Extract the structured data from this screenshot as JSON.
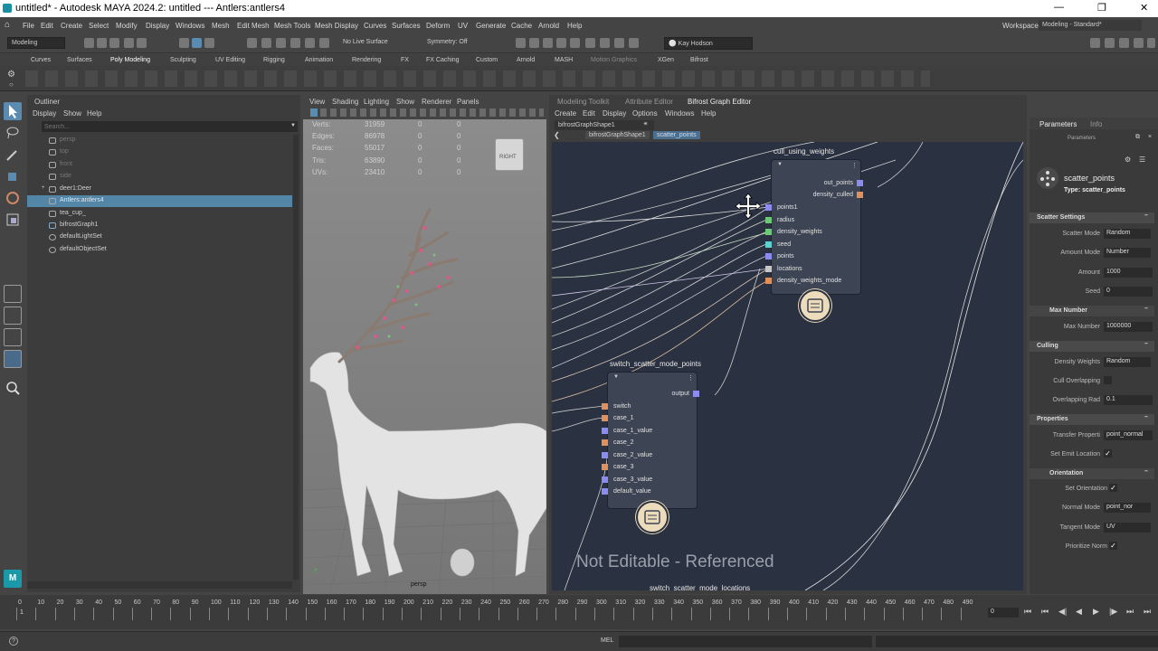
{
  "window": {
    "title": "untitled* - Autodesk MAYA 2024.2: untitled  ---  Antlers:antlers4"
  },
  "menu": [
    "File",
    "Edit",
    "Create",
    "Select",
    "Modify",
    "Display",
    "Windows",
    "Mesh",
    "Edit Mesh",
    "Mesh Tools",
    "Mesh Display",
    "Curves",
    "Surfaces",
    "Deform",
    "UV",
    "Generate",
    "Cache",
    "Arnold",
    "Help"
  ],
  "workspace": {
    "label": "Workspace:",
    "value": "Modeling - Standard*"
  },
  "status": {
    "mode": "Modeling",
    "live_surface": "No Live Surface",
    "symmetry": "Symmetry: Off",
    "user": "Kay Hodson"
  },
  "shelf_tabs": [
    "Curves",
    "Surfaces",
    "Poly Modeling",
    "Sculpting",
    "UV Editing",
    "Rigging",
    "Animation",
    "Rendering",
    "FX",
    "FX Caching",
    "Custom",
    "Arnold",
    "MASH",
    "Motion Graphics",
    "XGen",
    "Bifrost"
  ],
  "outliner": {
    "title": "Outliner",
    "menus": [
      "Display",
      "Show",
      "Help"
    ],
    "search_placeholder": "Search...",
    "items": [
      {
        "label": "persp",
        "dim": true
      },
      {
        "label": "top",
        "dim": true
      },
      {
        "label": "front",
        "dim": true
      },
      {
        "label": "side",
        "dim": true
      },
      {
        "label": "deer1:Deer",
        "dim": false
      },
      {
        "label": "Antlers:antlers4",
        "dim": false,
        "selected": true
      },
      {
        "label": "tea_cup_",
        "dim": false
      },
      {
        "label": "bifrostGraph1",
        "dim": false
      },
      {
        "label": "defaultLightSet",
        "dim": false
      },
      {
        "label": "defaultObjectSet",
        "dim": false
      }
    ]
  },
  "viewport": {
    "menus": [
      "View",
      "Shading",
      "Lighting",
      "Show",
      "Renderer",
      "Panels"
    ],
    "stats": [
      {
        "label": "Verts:",
        "v1": "31959",
        "v2": "0",
        "v3": "0"
      },
      {
        "label": "Edges:",
        "v1": "86978",
        "v2": "0",
        "v3": "0"
      },
      {
        "label": "Faces:",
        "v1": "55017",
        "v2": "0",
        "v3": "0"
      },
      {
        "label": "Tris:",
        "v1": "63890",
        "v2": "0",
        "v3": "0"
      },
      {
        "label": "UVs:",
        "v1": "23410",
        "v2": "0",
        "v3": "0"
      }
    ],
    "cube_label": "RIGHT",
    "camera": "persp"
  },
  "graph": {
    "tabs": [
      "Modeling Toolkit",
      "Attribute Editor",
      "Bifrost Graph Editor"
    ],
    "menus": [
      "Create",
      "Edit",
      "Display",
      "Options",
      "Windows",
      "Help"
    ],
    "doc_tab": "bifrostGraphShape1",
    "breadcrumbs": [
      "bifrostGraphShape1",
      "scatter_points"
    ],
    "watermark": "Not Editable - Referenced",
    "node1": {
      "title": "cull_using_weights",
      "outputs": [
        "out_points",
        "density_culled"
      ],
      "inputs": [
        "points1",
        "radius",
        "density_weights",
        "seed",
        "points",
        "locations",
        "density_weights_mode"
      ]
    },
    "node2": {
      "title": "switch_scatter_mode_points",
      "outputs": [
        "output"
      ],
      "inputs": [
        "switch",
        "case_1",
        "case_1_value",
        "case_2",
        "case_2_value",
        "case_3",
        "case_3_value",
        "default_value"
      ]
    },
    "node3_title": "switch_scatter_mode_locations"
  },
  "params": {
    "tabs": [
      "Parameters",
      "Info"
    ],
    "header": "Parameters",
    "node_name": "scatter_points",
    "node_type": "Type: scatter_points",
    "sections": {
      "scatter_settings": "Scatter Settings",
      "max_number": "Max Number",
      "culling": "Culling",
      "properties": "Properties",
      "orientation": "Orientation"
    },
    "fields": {
      "scatter_mode": {
        "label": "Scatter Mode",
        "value": "Random"
      },
      "amount_mode": {
        "label": "Amount Mode",
        "value": "Number"
      },
      "amount": {
        "label": "Amount",
        "value": "1000"
      },
      "seed": {
        "label": "Seed",
        "value": "0"
      },
      "max_number": {
        "label": "Max Number",
        "value": "1000000"
      },
      "density_weights": {
        "label": "Density Weights",
        "value": "Random"
      },
      "cull_overlapping": {
        "label": "Cull Overlapping"
      },
      "overlapping_rad": {
        "label": "Overlapping Rad",
        "value": "0.1"
      },
      "transfer_properties": {
        "label": "Transfer Properti",
        "value": "point_normal"
      },
      "set_emit_location": {
        "label": "Set Emit Location"
      },
      "set_orientation": {
        "label": "Set Orientation"
      },
      "normal_mode": {
        "label": "Normal Mode",
        "value": "point_nor"
      },
      "tangent_mode": {
        "label": "Tangent Mode",
        "value": "UV"
      },
      "prioritize_norm": {
        "label": "Prioritize Norm"
      }
    }
  },
  "timeline": {
    "ticks": [
      "0",
      "10",
      "20",
      "30",
      "40",
      "50",
      "60",
      "70",
      "80",
      "90",
      "100",
      "110",
      "120",
      "130",
      "140",
      "150",
      "160",
      "170",
      "180",
      "190",
      "200",
      "210",
      "220",
      "230",
      "240",
      "250",
      "260",
      "270",
      "280",
      "290",
      "300",
      "310",
      "320",
      "330",
      "340",
      "350",
      "360",
      "370",
      "380",
      "390",
      "400",
      "410",
      "420",
      "430",
      "440",
      "450",
      "460",
      "470",
      "480",
      "490"
    ],
    "current_frame": "0",
    "start_value": "1"
  },
  "command_line": {
    "lang": "MEL"
  },
  "colors": {
    "selection": "#5285a6",
    "graph_bg": "#2a3140",
    "node_bg": "#3d4554",
    "port_blue": "#8c8cf0",
    "port_orange": "#e0905a",
    "port_green": "#6ec87a",
    "port_cyan": "#5fd0d0"
  }
}
